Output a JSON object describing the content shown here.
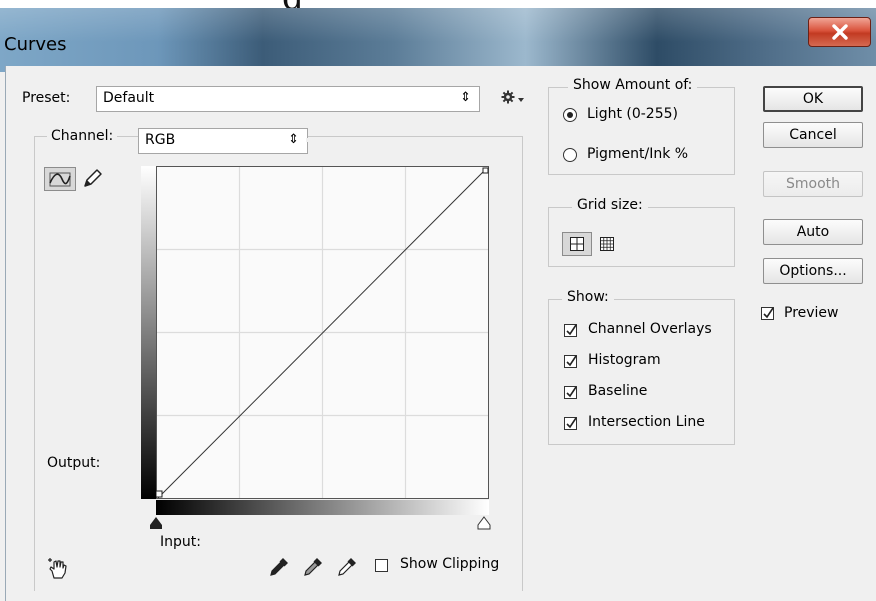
{
  "backdrop": {
    "text": "g"
  },
  "window": {
    "title": "Curves"
  },
  "preset": {
    "label": "Preset:",
    "value": "Default"
  },
  "channel": {
    "label": "Channel:",
    "value": "RGB"
  },
  "graph": {
    "output_label": "Output:",
    "input_label": "Input:",
    "grid_divisions": 4,
    "curve_points": [
      [
        0,
        0
      ],
      [
        255,
        255
      ]
    ]
  },
  "clipping": {
    "label": "Show Clipping",
    "checked": false
  },
  "show_amount": {
    "legend": "Show Amount of:",
    "options": [
      {
        "label": "Light  (0-255)",
        "selected": true
      },
      {
        "label": "Pigment/Ink %",
        "selected": false
      }
    ]
  },
  "grid_size": {
    "legend": "Grid size:",
    "selected": "simple"
  },
  "show": {
    "legend": "Show:",
    "items": [
      {
        "label": "Channel Overlays",
        "checked": true
      },
      {
        "label": "Histogram",
        "checked": true
      },
      {
        "label": "Baseline",
        "checked": true
      },
      {
        "label": "Intersection Line",
        "checked": true
      }
    ]
  },
  "buttons": {
    "ok": "OK",
    "cancel": "Cancel",
    "smooth": "Smooth",
    "auto": "Auto",
    "options": "Options..."
  },
  "preview": {
    "label": "Preview",
    "checked": true
  },
  "icons": {
    "close": "close-icon",
    "preset_options": "gear-icon",
    "curve_tool": "curve-edit-icon",
    "pencil_tool": "pencil-icon",
    "targeted_adjust": "hand-target-icon",
    "black_eyedropper": "eyedropper-black-icon",
    "gray_eyedropper": "eyedropper-gray-icon",
    "white_eyedropper": "eyedropper-white-icon"
  },
  "colors": {
    "background": "#f0f0f0",
    "close_button": "#c8412a",
    "grid": "#dcdcdc"
  }
}
